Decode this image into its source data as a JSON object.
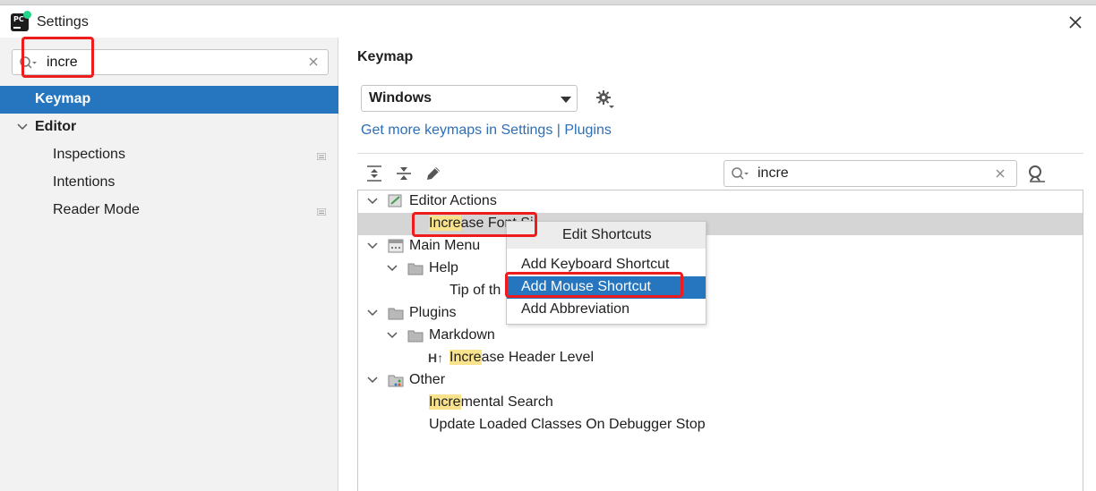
{
  "window": {
    "title": "Settings",
    "close_icon": "close-icon"
  },
  "sidebar": {
    "search_value": "incre",
    "items": [
      {
        "label": "Keymap",
        "selected": true
      },
      {
        "label": "Editor",
        "expanded": true
      },
      {
        "label": "Inspections"
      },
      {
        "label": "Intentions"
      },
      {
        "label": "Reader Mode"
      }
    ]
  },
  "main": {
    "title": "Keymap",
    "keymap_value": "Windows",
    "plugins_link": "Get more keymaps in Settings | Plugins",
    "filter_value": "incre"
  },
  "tree": {
    "editor_actions": "Editor Actions",
    "increase_font_hl": "Incre",
    "increase_font_rest": "ase Font Si",
    "main_menu": "Main Menu",
    "help": "Help",
    "tip_of": "Tip of th",
    "plugins": "Plugins",
    "markdown": "Markdown",
    "md_icon": "H↑",
    "increase_header_hl": "Incre",
    "increase_header_rest": "ase Header Level",
    "other": "Other",
    "incremental_hl": "Incre",
    "incremental_rest": "mental Search",
    "update_loaded": "Update Loaded Classes On Debugger Stop"
  },
  "context_menu": {
    "header": "Edit Shortcuts",
    "items": [
      "Add Keyboard Shortcut",
      "Add Mouse Shortcut",
      "Add Abbreviation"
    ],
    "active_index": 1
  },
  "colors": {
    "selection": "#2675bf",
    "highlight": "#f9e28c",
    "annotation": "#ee1c1c",
    "link": "#2d6fb6"
  }
}
